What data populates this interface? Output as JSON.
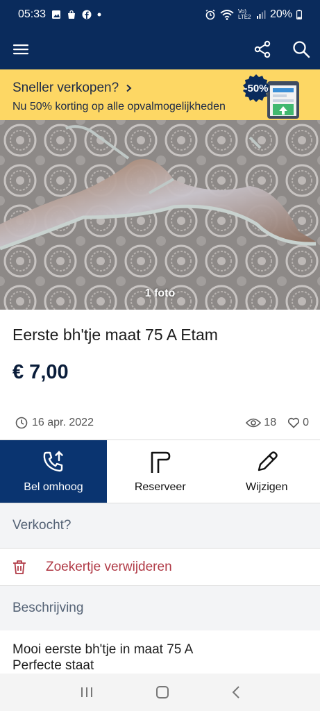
{
  "status": {
    "time": "05:33",
    "battery": "20%",
    "signal_label": "Vo) LTE2"
  },
  "promo": {
    "title": "Sneller verkopen?",
    "subtitle": "Nu 50% korting op alle opvalmogelijkheden",
    "badge": "-50%"
  },
  "photo": {
    "count_label": "1 foto"
  },
  "listing": {
    "title": "Eerste bh'tje maat 75 A Etam",
    "price": "€ 7,00",
    "date": "16 apr. 2022",
    "views": "18",
    "favorites": "0"
  },
  "actions": {
    "bump": "Bel omhoog",
    "reserve": "Reserveer",
    "edit": "Wijzigen"
  },
  "sold_label": "Verkocht?",
  "delete_label": "Zoekertje verwijderen",
  "description": {
    "heading": "Beschrijving",
    "line1": "Mooi eerste bh'tje in maat 75 A",
    "line2": "Perfecte staat"
  },
  "colors": {
    "brand": "#0a2b5c",
    "promo_bg": "#fdd764",
    "danger": "#b03a46"
  }
}
